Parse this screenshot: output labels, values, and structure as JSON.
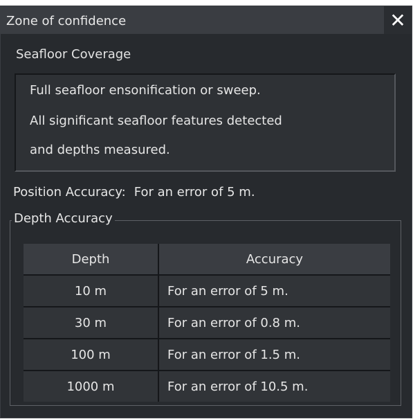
{
  "window": {
    "title": "Zone of confidence",
    "close_label": "✕"
  },
  "seafloor_coverage": {
    "label": "Seafloor Coverage",
    "lines": [
      "Full seafloor ensonification or sweep.",
      "All significant seafloor features detected",
      "and depths measured."
    ]
  },
  "position_accuracy": {
    "label": "Position Accuracy:",
    "value": "For an error of 5 m."
  },
  "depth_accuracy": {
    "group_label": "Depth Accuracy",
    "columns": [
      "Depth",
      "Accuracy"
    ],
    "rows": [
      {
        "depth": "10 m",
        "accuracy": "For an error of 5 m."
      },
      {
        "depth": "30 m",
        "accuracy": "For an error of 0.8 m."
      },
      {
        "depth": "100 m",
        "accuracy": "For an error of 1.5 m."
      },
      {
        "depth": "1000 m",
        "accuracy": "For an error of 10.5 m."
      }
    ]
  },
  "colors": {
    "background": "#272a2e",
    "titlebar": "#3a3d42",
    "text": "#e6e6e6"
  }
}
